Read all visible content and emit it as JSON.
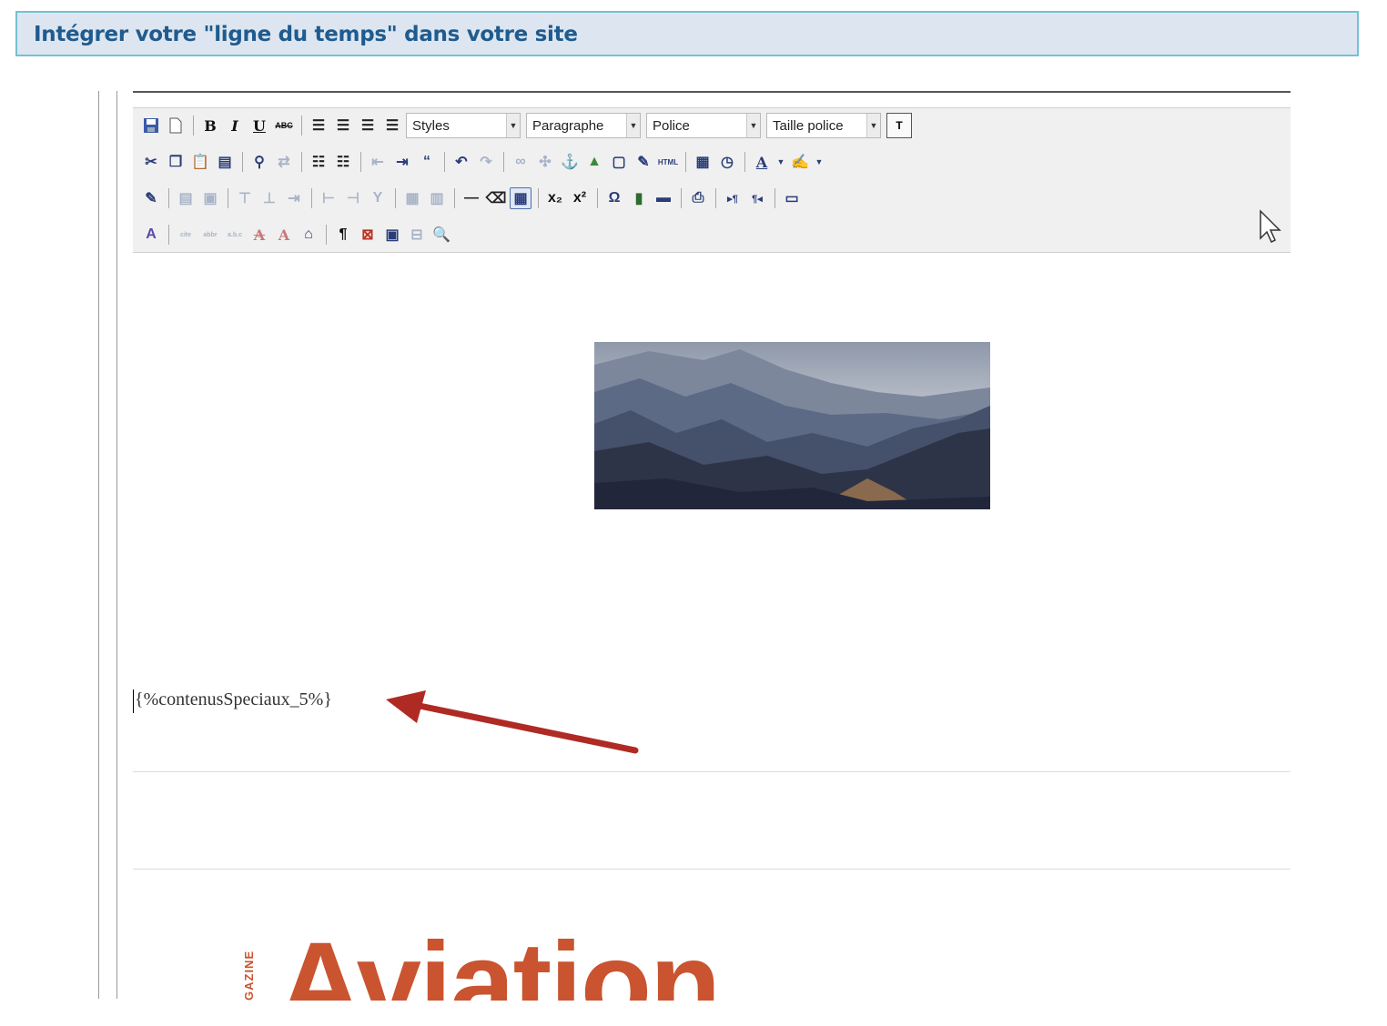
{
  "banner": {
    "title": "Intégrer votre \"ligne du temps\" dans votre site"
  },
  "toolbar": {
    "styles_label": "Styles",
    "format_label": "Paragraphe",
    "font_label": "Police",
    "size_label": "Taille police",
    "t_label": "T"
  },
  "editor": {
    "placeholder_text": "{%contenusSpeciaux_5%}"
  },
  "logo": {
    "word": "Aviation",
    "side_text": "GAZINE"
  },
  "colors": {
    "banner_bg": "#dde6f0",
    "banner_border": "#74c1d3",
    "title": "#1f5b8e",
    "arrow": "#b02a24",
    "logo": "#c9542f"
  }
}
